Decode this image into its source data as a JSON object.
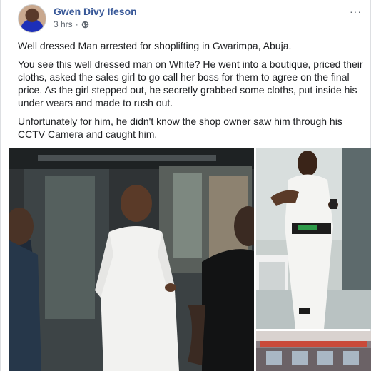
{
  "post": {
    "author": "Gwen Divy Ifeson",
    "time": "3 hrs",
    "dot": "·",
    "more": "···",
    "paragraphs": [
      "Well dressed Man arrested for shoplifting in Gwarimpa, Abuja.",
      "You see this well dressed man on White? He went into a boutique, priced their cloths, asked the sales girl to go call her boss for them to agree on the final price. As the girl stepped out, he secretly grabbed some cloths, put inside his under wears and made to rush out.",
      "Unfortunately for him, he didn't know the shop owner saw him through his CCTV Camera and caught him."
    ]
  },
  "icons": {
    "avatar": "avatar-photo",
    "privacy": "globe-icon",
    "more": "ellipsis-icon"
  },
  "colors": {
    "author_link": "#385898",
    "meta_text": "#606770",
    "body_text": "#1c1e21"
  }
}
